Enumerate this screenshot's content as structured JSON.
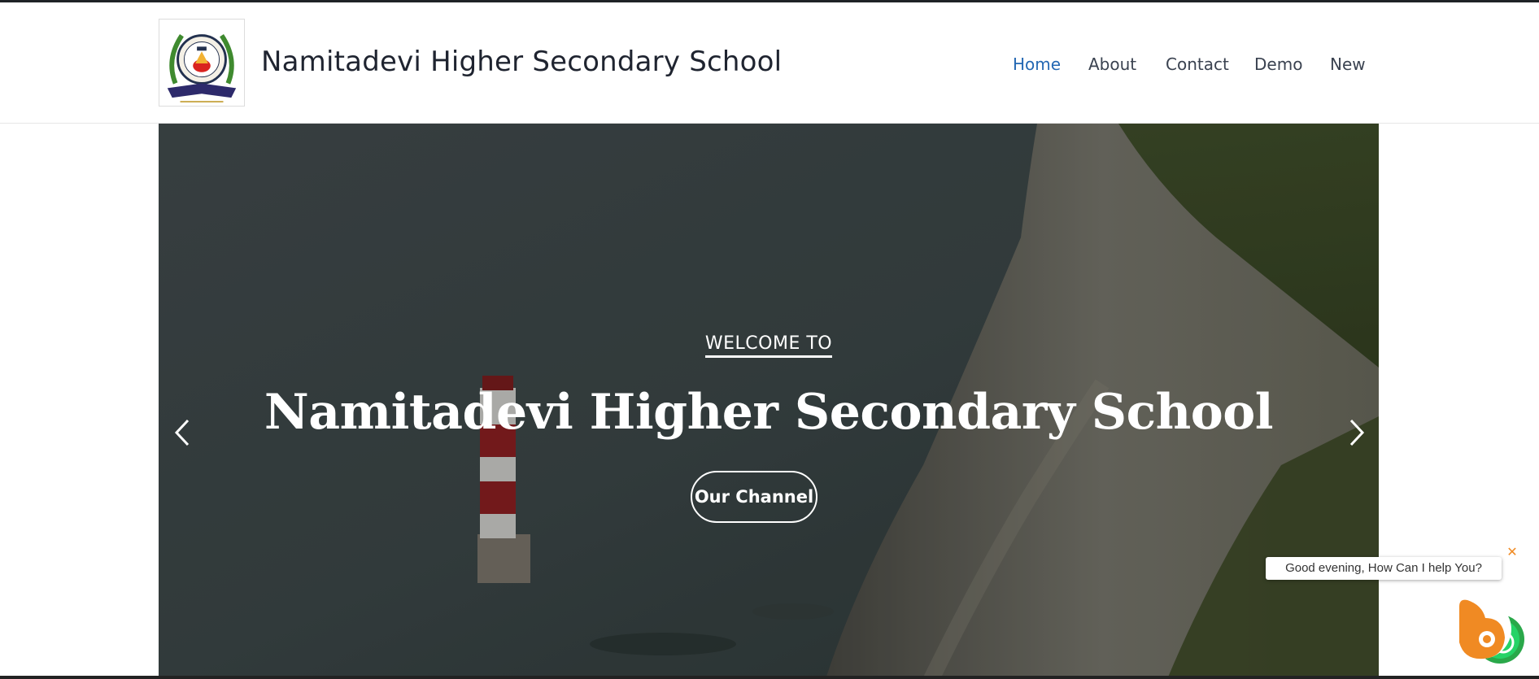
{
  "header": {
    "site_title": "Namitadevi Higher Secondary School",
    "logo_icon": "school-crest-logo"
  },
  "nav": {
    "items": [
      {
        "label": "Home",
        "active": true
      },
      {
        "label": "About",
        "active": false
      },
      {
        "label": "Contact",
        "active": false
      },
      {
        "label": "Demo",
        "active": false
      },
      {
        "label": "New",
        "active": false
      }
    ]
  },
  "hero": {
    "welcome": "WELCOME TO",
    "title": "Namitadevi Higher Secondary School",
    "button_label": "Our Channel",
    "prev_icon": "chevron-left-icon",
    "next_icon": "chevron-right-icon"
  },
  "chat": {
    "greeting": "Good evening, How Can I help You?",
    "close_symbol": "✕",
    "widget_icon": "chatbot-icon"
  },
  "colors": {
    "nav_active": "#2468b3",
    "nav_text": "#3a4250",
    "chat_accent": "#f08a23",
    "whatsapp_green": "#25d366"
  }
}
